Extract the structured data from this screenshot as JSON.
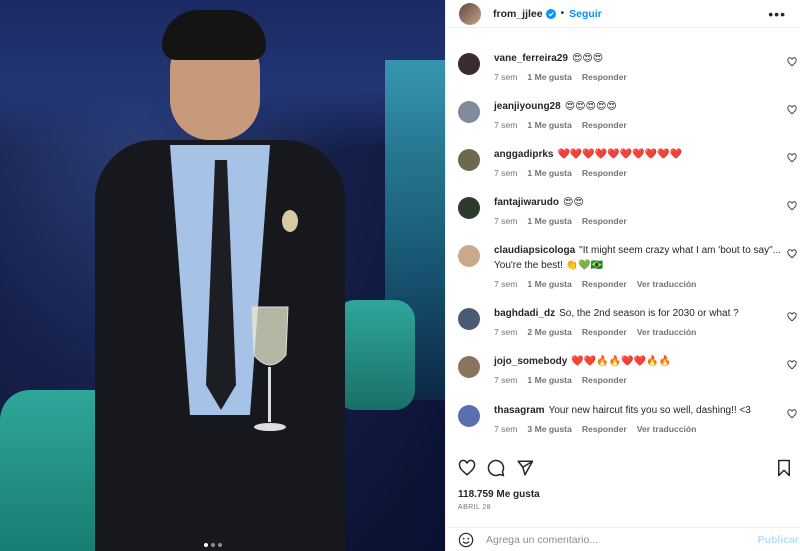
{
  "header": {
    "username": "from_jjlee",
    "separator": "•",
    "follow_label": "Seguir",
    "more_label": "•••"
  },
  "comments": [
    {
      "user": "vane_ferreira29",
      "text": "😍😍😍",
      "age": "7 sem",
      "likes": "1 Me gusta",
      "reply": "Responder",
      "translate": "",
      "avatar_color": "#3b2a2e"
    },
    {
      "user": "jeanjiyoung28",
      "text": "😍😍😍😍😍",
      "age": "7 sem",
      "likes": "1 Me gusta",
      "reply": "Responder",
      "translate": "",
      "avatar_color": "#7f8b98"
    },
    {
      "user": "anggadiprks",
      "text": "❤️❤️❤️❤️❤️❤️❤️❤️❤️❤️",
      "age": "7 sem",
      "likes": "1 Me gusta",
      "reply": "Responder",
      "translate": "",
      "avatar_color": "#6b6a4e"
    },
    {
      "user": "fantajiwarudo",
      "text": "😍😍",
      "age": "7 sem",
      "likes": "1 Me gusta",
      "reply": "Responder",
      "translate": "",
      "avatar_color": "#2f3a2e"
    },
    {
      "user": "claudiapsicologa",
      "text": "\"It might seem crazy what I am 'bout to say\"... You're the best! 👏💚🇧🇷",
      "age": "7 sem",
      "likes": "1 Me gusta",
      "reply": "Responder",
      "translate": "Ver traducción",
      "avatar_color": "#c9a98a"
    },
    {
      "user": "baghdadi_dz",
      "text": "So, the 2nd season is for 2030 or what ?",
      "age": "7 sem",
      "likes": "2 Me gusta",
      "reply": "Responder",
      "translate": "Ver traducción",
      "avatar_color": "#4a5a72"
    },
    {
      "user": "jojo_somebody",
      "text": "❤️❤️🔥🔥❤️❤️🔥🔥",
      "age": "7 sem",
      "likes": "1 Me gusta",
      "reply": "Responder",
      "translate": "",
      "avatar_color": "#8a7460"
    },
    {
      "user": "thasagram",
      "text": "Your new haircut fits you so well, dashing!! <3",
      "age": "7 sem",
      "likes": "3 Me gusta",
      "reply": "Responder",
      "translate": "Ver traducción",
      "avatar_color": "#5a6fb0"
    }
  ],
  "likes_count": "118.759 Me gusta",
  "post_date": "ABRIL 28",
  "add_comment": {
    "placeholder": "Agrega un comentario...",
    "post_label": "Publicar"
  },
  "colors": {
    "accent": "#0095f6",
    "muted": "#737373",
    "post_disabled": "#b2dffc"
  }
}
